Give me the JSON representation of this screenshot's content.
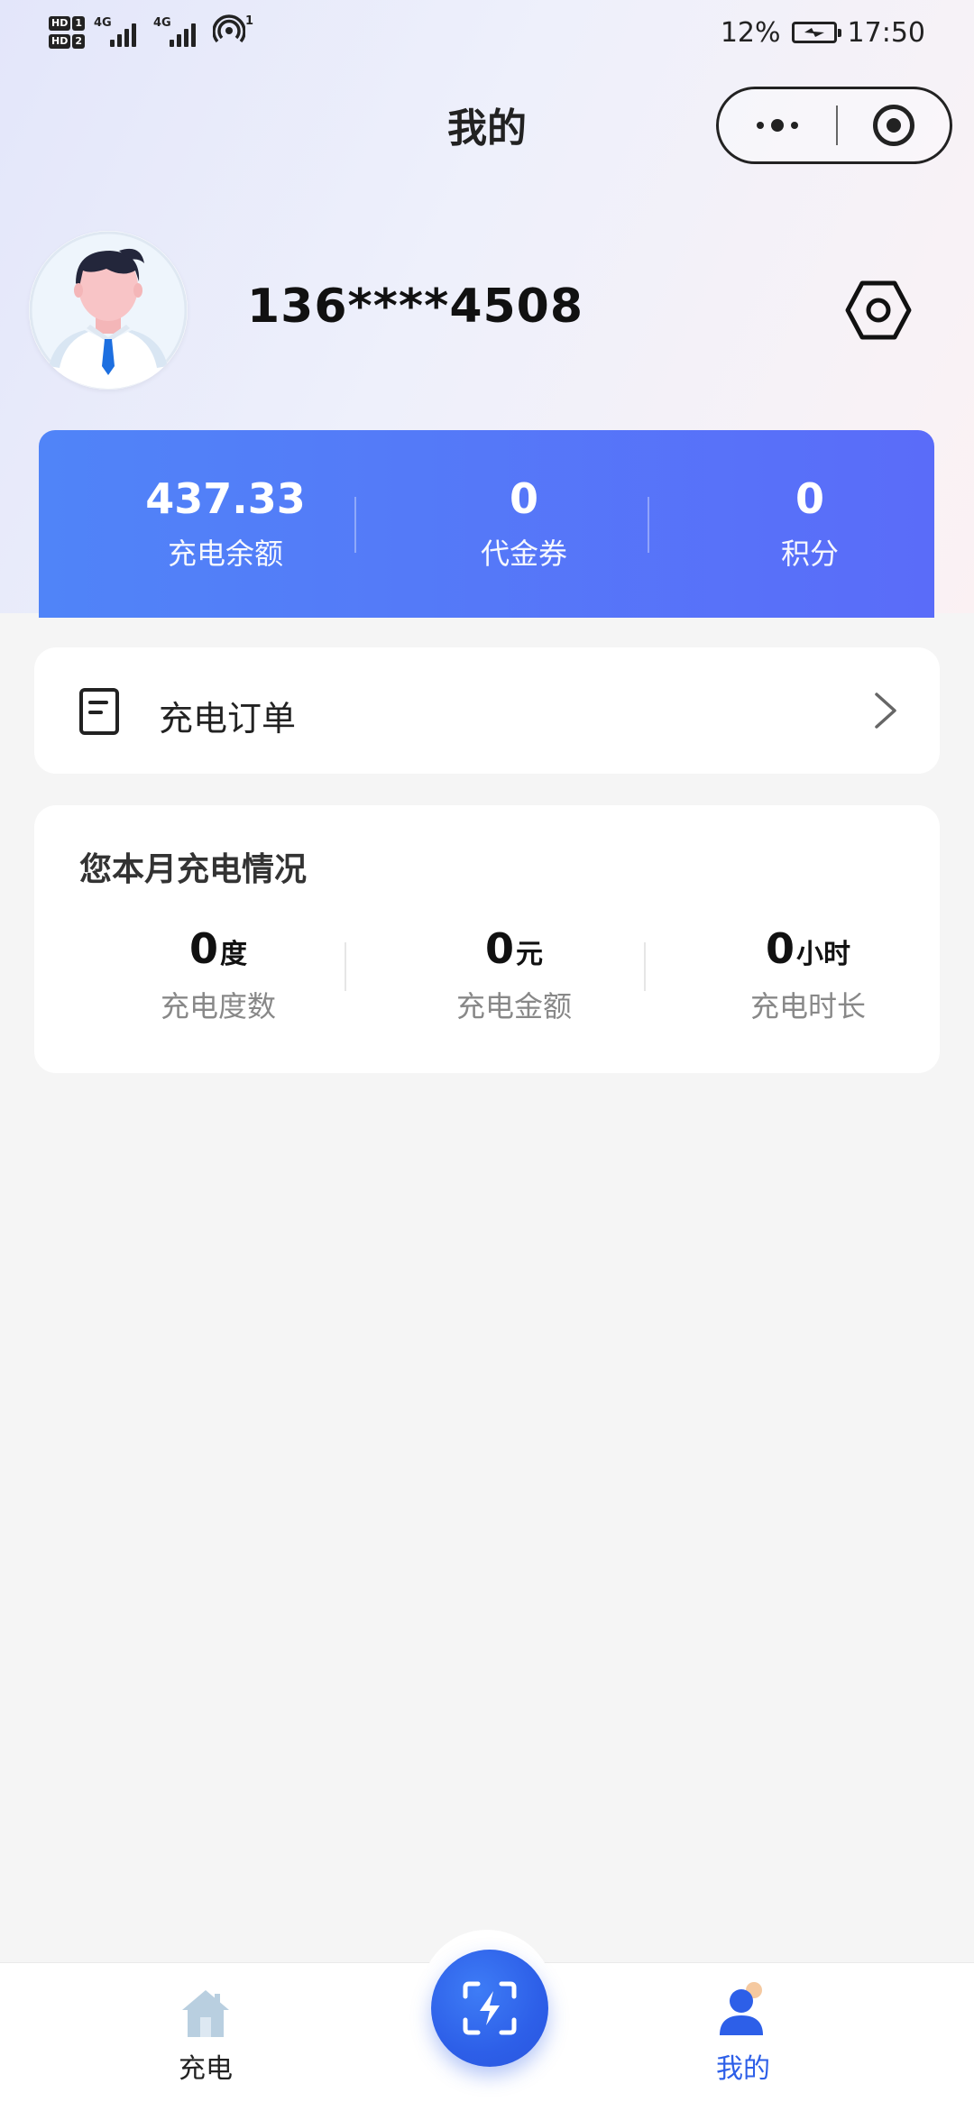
{
  "status_bar": {
    "hd1": "HD",
    "hd1_sim": "1",
    "hd2": "HD",
    "hd2_sim": "2",
    "net1": "4G",
    "net2": "4G",
    "hotspot_count": "1",
    "battery": "12%",
    "time": "17:50"
  },
  "nav": {
    "title": "我的"
  },
  "profile": {
    "phone": "136****4508"
  },
  "wallet": {
    "balance_value": "437.33",
    "balance_label": "充电余额",
    "voucher_value": "0",
    "voucher_label": "代金券",
    "points_value": "0",
    "points_label": "积分"
  },
  "orders": {
    "label": "充电订单"
  },
  "monthly": {
    "title": "您本月充电情况",
    "items": [
      {
        "value": "0",
        "unit": "度",
        "label": "充电度数"
      },
      {
        "value": "0",
        "unit": "元",
        "label": "充电金额"
      },
      {
        "value": "0",
        "unit": "小时",
        "label": "充电时长"
      }
    ]
  },
  "tabbar": {
    "home_label": "充电",
    "mine_label": "我的",
    "active_color": "#2d5fe8",
    "inactive_color": "#222222"
  },
  "colors": {
    "card_gradient_start": "#5084f8",
    "card_gradient_end": "#5a6cf9",
    "page_bg": "#f5f5f5"
  }
}
